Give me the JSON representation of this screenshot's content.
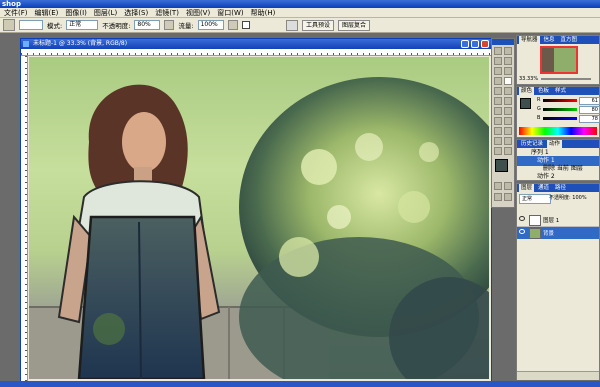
{
  "app": {
    "title": "shop"
  },
  "menu": [
    "文件(F)",
    "编辑(E)",
    "图像(I)",
    "图层(L)",
    "选择(S)",
    "滤镜(T)",
    "视图(V)",
    "窗口(W)",
    "帮助(H)"
  ],
  "options": {
    "mode_label": "模式:",
    "mode_value": "正常",
    "opacity_label": "不透明度:",
    "opacity_value": "80%",
    "flow_label": "流量:",
    "flow_value": "100%",
    "tab1": "工具预设",
    "tab2": "图层复合"
  },
  "document": {
    "title": "未标题-1 @ 33.3% (背景, RGB/8)"
  },
  "panels": {
    "navigator": {
      "tabs": [
        "导航器",
        "信息",
        "直方图"
      ],
      "zoom": "33.33%"
    },
    "color": {
      "tabs": [
        "颜色",
        "色板",
        "样式"
      ],
      "r_label": "R",
      "r_value": "61",
      "g_label": "G",
      "g_value": "80",
      "b_label": "B",
      "b_value": "78"
    },
    "history": {
      "tabs": [
        "历史记录",
        "动作"
      ],
      "items": [
        "序列 1",
        "动作 1",
        "删除 当前 图层",
        "动作 2"
      ]
    },
    "layers": {
      "tabs": [
        "图层",
        "通道",
        "路径"
      ],
      "blend": "正常",
      "opacity": "不透明度: 100%",
      "items": [
        "图层 1",
        "背景"
      ]
    }
  },
  "colors": {
    "accent": "#0a3fb8",
    "menubar": "#ece9d8",
    "foreground": "#3d504e",
    "background": "#c9d68f"
  }
}
